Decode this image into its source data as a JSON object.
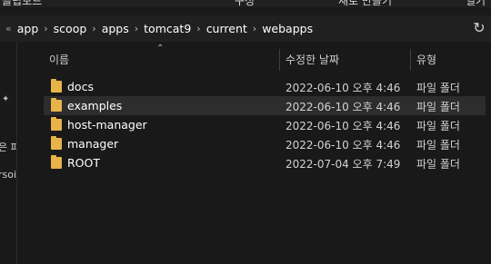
{
  "top_strip": {
    "left_fragment": "클립보드",
    "mid_fragment": "구성",
    "right_fragment": "새로 만들기",
    "far_right_fragment": "열기"
  },
  "breadcrumb": {
    "items": [
      "app",
      "scoop",
      "apps",
      "tomcat9",
      "current",
      "webapps"
    ]
  },
  "nav": {
    "fragment_1": "은 파",
    "fragment_2": "rsoi"
  },
  "columns": {
    "name": "이름",
    "date": "수정한 날짜",
    "type": "유형"
  },
  "files": [
    {
      "name": "docs",
      "date": "2022-06-10 오후 4:46",
      "type": "파일 폴더"
    },
    {
      "name": "examples",
      "date": "2022-06-10 오후 4:46",
      "type": "파일 폴더"
    },
    {
      "name": "host-manager",
      "date": "2022-06-10 오후 4:46",
      "type": "파일 폴더"
    },
    {
      "name": "manager",
      "date": "2022-06-10 오후 4:46",
      "type": "파일 폴더"
    },
    {
      "name": "ROOT",
      "date": "2022-07-04 오후 7:49",
      "type": "파일 폴더"
    }
  ],
  "selected_row": 1,
  "colors": {
    "folder": "#e8b44a",
    "selected": "#2d2d2d",
    "background": "#191919"
  }
}
